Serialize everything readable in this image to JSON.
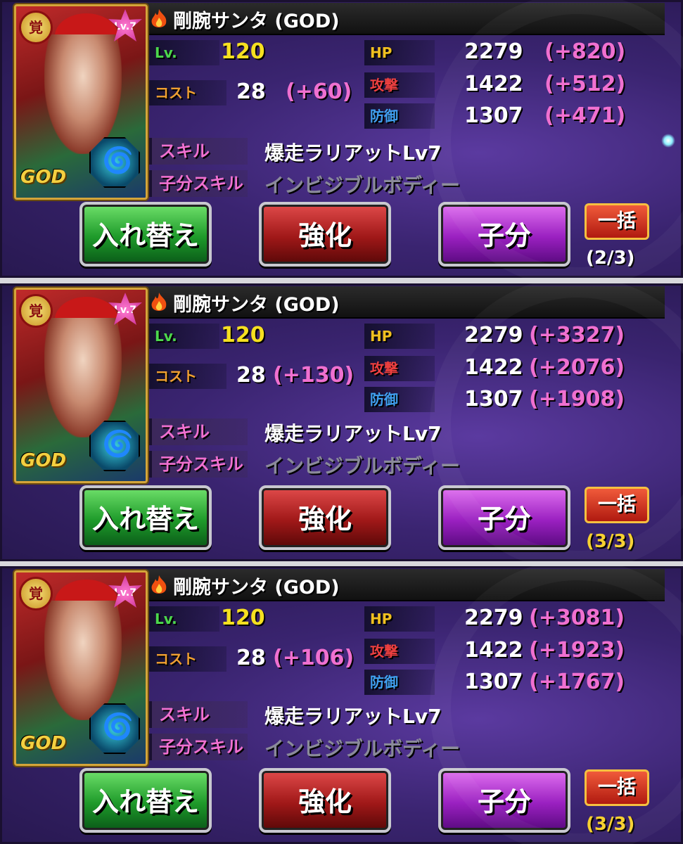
{
  "colors": {
    "label_lv": "#4cd84c",
    "label_cost": "#f0a030",
    "label_hp": "#f0c020",
    "label_atk": "#f04040",
    "label_def": "#40a0f0",
    "label_skill": "#f070d0",
    "count_white": "#ffffff",
    "count_yellow": "#f6d030"
  },
  "icons": {
    "flame": "flame-icon",
    "element": "wind-element-icon"
  },
  "panels": [
    {
      "name": "剛腕サンタ (GOD)",
      "awaken": "覚",
      "card_lv": "Lv.7",
      "rarity": "GOD",
      "lv_label": "Lv.",
      "lv": "120",
      "cost_label": "コスト",
      "cost": "28",
      "cost_plus": "(+60)",
      "hp_label": "HP",
      "hp": "2279",
      "hp_plus": "(+820)",
      "atk_label": "攻撃",
      "atk": "1422",
      "atk_plus": "(+512)",
      "def_label": "防御",
      "def": "1307",
      "def_plus": "(+471)",
      "skill_label": "スキル",
      "skill": "爆走ラリアットLv7",
      "child_skill_label": "子分スキル",
      "child_skill": "インビジブルボディー",
      "btn_swap": "入れ替え",
      "btn_enhance": "強化",
      "btn_child": "子分",
      "btn_bulk": "一括",
      "count": "(2/3)"
    },
    {
      "name": "剛腕サンタ (GOD)",
      "awaken": "覚",
      "card_lv": "Lv.7",
      "rarity": "GOD",
      "lv_label": "Lv.",
      "lv": "120",
      "cost_label": "コスト",
      "cost": "28",
      "cost_plus": "(+130)",
      "hp_label": "HP",
      "hp": "2279",
      "hp_plus": "(+3327)",
      "atk_label": "攻撃",
      "atk": "1422",
      "atk_plus": "(+2076)",
      "def_label": "防御",
      "def": "1307",
      "def_plus": "(+1908)",
      "skill_label": "スキル",
      "skill": "爆走ラリアットLv7",
      "child_skill_label": "子分スキル",
      "child_skill": "インビジブルボディー",
      "btn_swap": "入れ替え",
      "btn_enhance": "強化",
      "btn_child": "子分",
      "btn_bulk": "一括",
      "count": "(3/3)"
    },
    {
      "name": "剛腕サンタ (GOD)",
      "awaken": "覚",
      "card_lv": "Lv.7",
      "rarity": "GOD",
      "lv_label": "Lv.",
      "lv": "120",
      "cost_label": "コスト",
      "cost": "28",
      "cost_plus": "(+106)",
      "hp_label": "HP",
      "hp": "2279",
      "hp_plus": "(+3081)",
      "atk_label": "攻撃",
      "atk": "1422",
      "atk_plus": "(+1923)",
      "def_label": "防御",
      "def": "1307",
      "def_plus": "(+1767)",
      "skill_label": "スキル",
      "skill": "爆走ラリアットLv7",
      "child_skill_label": "子分スキル",
      "child_skill": "インビジブルボディー",
      "btn_swap": "入れ替え",
      "btn_enhance": "強化",
      "btn_child": "子分",
      "btn_bulk": "一括",
      "count": "(3/3)"
    }
  ]
}
